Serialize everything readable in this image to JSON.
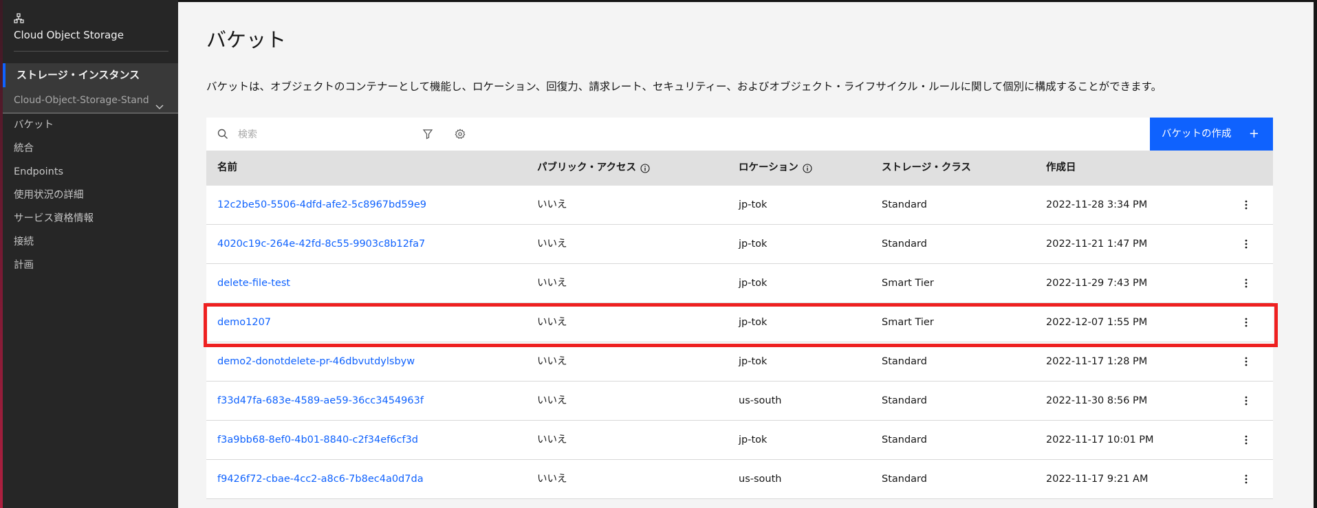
{
  "sidebar": {
    "brand_icon": "storage-instance-icon",
    "brand_title": "Cloud Object Storage",
    "instance_header": "ストレージ・インスタンス",
    "instance_select": "Cloud-Object-Storage-Standa",
    "items": [
      {
        "label": "バケット"
      },
      {
        "label": "統合"
      },
      {
        "label": "Endpoints"
      },
      {
        "label": "使用状況の詳細"
      },
      {
        "label": "サービス資格情報"
      },
      {
        "label": "接続"
      },
      {
        "label": "計画"
      }
    ]
  },
  "main": {
    "title": "バケット",
    "description": "バケットは、オブジェクトのコンテナーとして機能し、ロケーション、回復力、請求レート、セキュリティー、およびオブジェクト・ライフサイクル・ルールに関して個別に構成することができます。",
    "search": {
      "placeholder": "検索",
      "value": ""
    },
    "create_button": "バケットの作成",
    "create_icon": "+",
    "columns": {
      "name": "名前",
      "public_access": "パブリック・アクセス",
      "location": "ロケーション",
      "storage_class": "ストレージ・クラス",
      "created": "作成日"
    },
    "rows": [
      {
        "name": "12c2be50-5506-4dfd-afe2-5c8967bd59e9",
        "public_access": "いいえ",
        "location": "jp-tok",
        "storage_class": "Standard",
        "created": "2022-11-28 3:34 PM"
      },
      {
        "name": "4020c19c-264e-42fd-8c55-9903c8b12fa7",
        "public_access": "いいえ",
        "location": "jp-tok",
        "storage_class": "Standard",
        "created": "2022-11-21 1:47 PM"
      },
      {
        "name": "delete-file-test",
        "public_access": "いいえ",
        "location": "jp-tok",
        "storage_class": "Smart Tier",
        "created": "2022-11-29 7:43 PM"
      },
      {
        "name": "demo1207",
        "public_access": "いいえ",
        "location": "jp-tok",
        "storage_class": "Smart Tier",
        "created": "2022-12-07 1:55 PM"
      },
      {
        "name": "demo2-donotdelete-pr-46dbvutdylsbyw",
        "public_access": "いいえ",
        "location": "jp-tok",
        "storage_class": "Standard",
        "created": "2022-11-17 1:28 PM"
      },
      {
        "name": "f33d47fa-683e-4589-ae59-36cc3454963f",
        "public_access": "いいえ",
        "location": "us-south",
        "storage_class": "Standard",
        "created": "2022-11-30 8:56 PM"
      },
      {
        "name": "f3a9bb68-8ef0-4b01-8840-c2f34ef6cf3d",
        "public_access": "いいえ",
        "location": "jp-tok",
        "storage_class": "Standard",
        "created": "2022-11-17 10:01 PM"
      },
      {
        "name": "f9426f72-cbae-4cc2-a8c6-7b8ec4a0d7da",
        "public_access": "いいえ",
        "location": "us-south",
        "storage_class": "Standard",
        "created": "2022-11-17 9:21 AM"
      }
    ],
    "highlighted_row": "demo1207"
  },
  "colors": {
    "accent": "#0f62fe",
    "highlight": "#ee2020",
    "sidebar_bg": "#262626"
  }
}
